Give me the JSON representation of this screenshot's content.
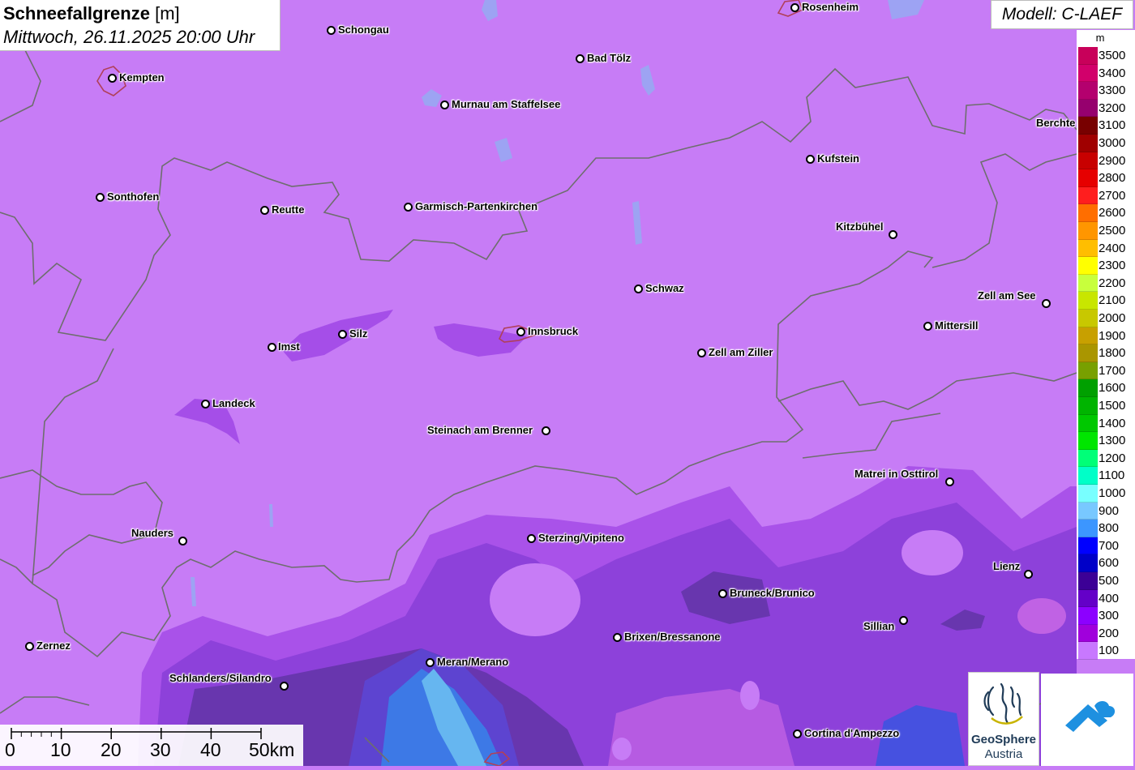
{
  "title": {
    "main": "Schneefallgrenze",
    "unit": "[m]",
    "subtitle": "Mittwoch, 26.11.2025 20:00 Uhr"
  },
  "model": "Modell: C-LAEF",
  "legend": {
    "unit": "m",
    "items": [
      {
        "label": "3500",
        "color": "#c8005a"
      },
      {
        "label": "3400",
        "color": "#d2006b"
      },
      {
        "label": "3300",
        "color": "#b4006e"
      },
      {
        "label": "3200",
        "color": "#96006e"
      },
      {
        "label": "3100",
        "color": "#780000"
      },
      {
        "label": "3000",
        "color": "#a00000"
      },
      {
        "label": "2900",
        "color": "#c80000"
      },
      {
        "label": "2800",
        "color": "#e60000"
      },
      {
        "label": "2700",
        "color": "#ff1e1e"
      },
      {
        "label": "2600",
        "color": "#ff6e00"
      },
      {
        "label": "2500",
        "color": "#ff9600"
      },
      {
        "label": "2400",
        "color": "#ffbe00"
      },
      {
        "label": "2300",
        "color": "#ffff00"
      },
      {
        "label": "2200",
        "color": "#c8ff3c"
      },
      {
        "label": "2100",
        "color": "#c8e600"
      },
      {
        "label": "2000",
        "color": "#c8c800"
      },
      {
        "label": "1900",
        "color": "#c8a000"
      },
      {
        "label": "1800",
        "color": "#aa9600"
      },
      {
        "label": "1700",
        "color": "#78a000"
      },
      {
        "label": "1600",
        "color": "#00a000"
      },
      {
        "label": "1500",
        "color": "#00b400"
      },
      {
        "label": "1400",
        "color": "#00c800"
      },
      {
        "label": "1300",
        "color": "#00e600"
      },
      {
        "label": "1200",
        "color": "#00ff78"
      },
      {
        "label": "1100",
        "color": "#00ffc8"
      },
      {
        "label": "1000",
        "color": "#78ffff"
      },
      {
        "label": "900",
        "color": "#78c8ff"
      },
      {
        "label": "800",
        "color": "#3c96ff"
      },
      {
        "label": "700",
        "color": "#0000ff"
      },
      {
        "label": "600",
        "color": "#0000c8"
      },
      {
        "label": "500",
        "color": "#3c0096"
      },
      {
        "label": "400",
        "color": "#6400c8"
      },
      {
        "label": "300",
        "color": "#8c00ff"
      },
      {
        "label": "200",
        "color": "#a000dc"
      },
      {
        "label": "100",
        "color": "#c878ff"
      }
    ]
  },
  "scale": {
    "labels": [
      "0",
      "10",
      "20",
      "30",
      "40",
      "50km"
    ]
  },
  "cities": [
    {
      "name": "Rosenheim"
    },
    {
      "name": "Schongau"
    },
    {
      "name": "Kempten"
    },
    {
      "name": "Bad Tölz"
    },
    {
      "name": "Murnau am Staffelsee"
    },
    {
      "name": "Berchte"
    },
    {
      "name": "Kufstein"
    },
    {
      "name": "Sonthofen"
    },
    {
      "name": "Reutte"
    },
    {
      "name": "Garmisch-Partenkirchen"
    },
    {
      "name": "Kitzbühel"
    },
    {
      "name": "Schwaz"
    },
    {
      "name": "Zell am See"
    },
    {
      "name": "Mittersill"
    },
    {
      "name": "Silz"
    },
    {
      "name": "Innsbruck"
    },
    {
      "name": "Imst"
    },
    {
      "name": "Zell am Ziller"
    },
    {
      "name": "Landeck"
    },
    {
      "name": "Steinach am Brenner"
    },
    {
      "name": "Matrei in Osttirol"
    },
    {
      "name": "Nauders"
    },
    {
      "name": "Sterzing/Vipiteno"
    },
    {
      "name": "Lienz"
    },
    {
      "name": "Bruneck/Brunico"
    },
    {
      "name": "Sillian"
    },
    {
      "name": "Brixen/Bressanone"
    },
    {
      "name": "Zernez"
    },
    {
      "name": "Meran/Merano"
    },
    {
      "name": "Schlanders/Silandro"
    },
    {
      "name": "Cortina d'Ampezzo"
    }
  ],
  "logos": {
    "geosphere_line1": "GeoSphere",
    "geosphere_line2": "Austria"
  },
  "colors": {
    "base": "#c77cf6",
    "snowline_200": "#a54ee8",
    "snowline_300": "#8a3fd8",
    "snowline_500": "#4a2e8a",
    "snowline_800": "#3a7fe8",
    "snowline_900": "#66b6f0"
  }
}
